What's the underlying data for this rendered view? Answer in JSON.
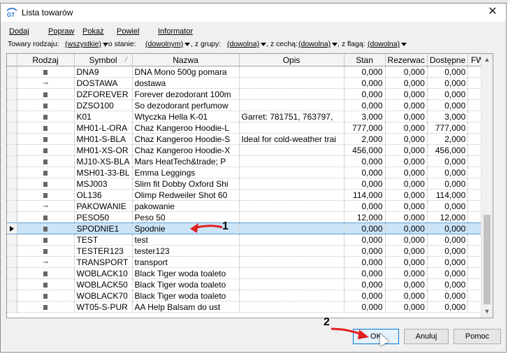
{
  "window": {
    "title": "Lista towarów"
  },
  "menu": [
    "Dodaj",
    "Popraw",
    "Pokaż",
    "Powiel",
    "Informator"
  ],
  "filters": {
    "kind_label": "Towary rodzaju:",
    "kind_value": "(wszystkie)",
    "state_label": ", o stanie:",
    "state_value": "(dowolnym)",
    "group_label": ", z grupy:",
    "group_value": "(dowolna)",
    "feature_label": ", z cechą:",
    "feature_value": "(dowolna)",
    "flag_label": ", z flagą:",
    "flag_value": "(dowolna)"
  },
  "table": {
    "headers": [
      "Rodzaj",
      "Symbol",
      "Nazwa",
      "Opis",
      "Stan",
      "Rezerwac",
      "Dostępne",
      "FW"
    ],
    "rows": [
      {
        "kind": "towar",
        "symbol": "DNA9",
        "name": "DNA Mono 500g pomara",
        "desc": "",
        "stan": "0,000",
        "rez": "0,000",
        "dost": "0,000"
      },
      {
        "kind": "usluga",
        "symbol": "DOSTAWA",
        "name": "dostawa",
        "desc": "",
        "stan": "0,000",
        "rez": "0,000",
        "dost": "0,000"
      },
      {
        "kind": "towar",
        "symbol": "DZFOREVER",
        "name": "Forever dezodorant 100m",
        "desc": "",
        "stan": "0,000",
        "rez": "0,000",
        "dost": "0,000"
      },
      {
        "kind": "towar",
        "symbol": "DZSO100",
        "name": "So dezodorant perfumow",
        "desc": "",
        "stan": "0,000",
        "rez": "0,000",
        "dost": "0,000"
      },
      {
        "kind": "towar",
        "symbol": "K01",
        "name": "Wtyczka Hella K-01",
        "desc": "Garret: 781751, 763797,",
        "stan": "3,000",
        "rez": "0,000",
        "dost": "3,000"
      },
      {
        "kind": "towar",
        "symbol": "MH01-L-ORA",
        "name": "Chaz Kangeroo Hoodie-L",
        "desc": "",
        "stan": "777,000",
        "rez": "0,000",
        "dost": "777,000"
      },
      {
        "kind": "towar",
        "symbol": "MH01-S-BLA",
        "name": "Chaz Kangeroo Hoodie-S",
        "desc": "Ideal for cold-weather trai",
        "stan": "2,000",
        "rez": "0,000",
        "dost": "2,000"
      },
      {
        "kind": "towar",
        "symbol": "MH01-XS-OR",
        "name": "Chaz Kangeroo Hoodie-X",
        "desc": "",
        "stan": "456,000",
        "rez": "0,000",
        "dost": "456,000"
      },
      {
        "kind": "towar",
        "symbol": "MJ10-XS-BLA",
        "name": "Mars HeatTech&trade; P",
        "desc": "",
        "stan": "0,000",
        "rez": "0,000",
        "dost": "0,000"
      },
      {
        "kind": "towar",
        "symbol": "MSH01-33-BL",
        "name": "Emma Leggings",
        "desc": "",
        "stan": "0,000",
        "rez": "0,000",
        "dost": "0,000"
      },
      {
        "kind": "towar",
        "symbol": "MSJ003",
        "name": "Slim fit Dobby Oxford Shi",
        "desc": "",
        "stan": "0,000",
        "rez": "0,000",
        "dost": "0,000"
      },
      {
        "kind": "towar",
        "symbol": "OL136",
        "name": "Olimp Redweiler  Shot 60",
        "desc": "",
        "stan": "114,000",
        "rez": "0,000",
        "dost": "114,000"
      },
      {
        "kind": "usluga",
        "symbol": "PAKOWANIE",
        "name": "pakowanie",
        "desc": "",
        "stan": "0,000",
        "rez": "0,000",
        "dost": "0,000"
      },
      {
        "kind": "towar",
        "symbol": "PESO50",
        "name": "Peso 50",
        "desc": "",
        "stan": "12,000",
        "rez": "0,000",
        "dost": "12,000"
      },
      {
        "kind": "towar",
        "symbol": "SPODNIE1",
        "name": "Spodnie",
        "desc": "",
        "stan": "0,000",
        "rez": "0,000",
        "dost": "0,000",
        "selected": true
      },
      {
        "kind": "towar",
        "symbol": "TEST",
        "name": "test",
        "desc": "",
        "stan": "0,000",
        "rez": "0,000",
        "dost": "0,000"
      },
      {
        "kind": "towar",
        "symbol": "TESTER123",
        "name": "tester123",
        "desc": "",
        "stan": "0,000",
        "rez": "0,000",
        "dost": "0,000"
      },
      {
        "kind": "usluga",
        "symbol": "TRANSPORT",
        "name": "transport",
        "desc": "",
        "stan": "0,000",
        "rez": "0,000",
        "dost": "0,000"
      },
      {
        "kind": "towar",
        "symbol": "WOBLACK10",
        "name": "Black Tiger woda toaleto",
        "desc": "",
        "stan": "0,000",
        "rez": "0,000",
        "dost": "0,000"
      },
      {
        "kind": "towar",
        "symbol": "WOBLACK50",
        "name": "Black Tiger woda toaleto",
        "desc": "",
        "stan": "0,000",
        "rez": "0,000",
        "dost": "0,000"
      },
      {
        "kind": "towar",
        "symbol": "WOBLACK70",
        "name": "Black Tiger woda toaleto",
        "desc": "",
        "stan": "0,000",
        "rez": "0,000",
        "dost": "0,000"
      },
      {
        "kind": "towar",
        "symbol": "WT05-S-PUR",
        "name": "AA Help Balsam do ust",
        "desc": "",
        "stan": "0,000",
        "rez": "0,000",
        "dost": "0,000"
      }
    ]
  },
  "buttons": {
    "ok": "OK",
    "cancel": "Anuluj",
    "help": "Pomoc"
  },
  "annotations": {
    "one": "1",
    "two": "2"
  },
  "colors": {
    "selection": "#cce4f7",
    "annotation_arrow": "#e02020"
  }
}
